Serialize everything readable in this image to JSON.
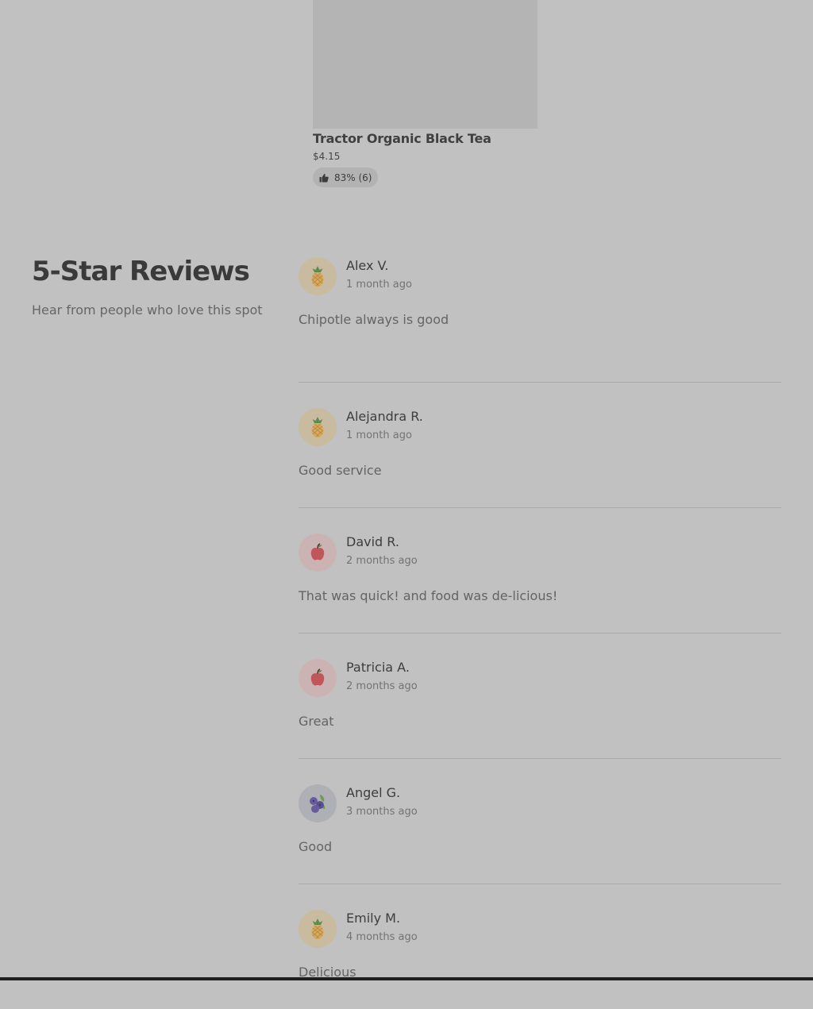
{
  "product": {
    "name": "Tractor Organic Black Tea",
    "price": "$4.15",
    "rating": "83% (6)",
    "rating_icon": "thumbs-up-icon"
  },
  "reviews_section": {
    "title": "5-Star Reviews",
    "subtitle": "Hear from people who love this spot"
  },
  "reviews": [
    {
      "name": "Alex V.",
      "date": "1 month ago",
      "text": "Chipotle always is good",
      "avatar": "pineapple-icon"
    },
    {
      "name": "Alejandra R.",
      "date": "1 month ago",
      "text": "Good service",
      "avatar": "pineapple-icon"
    },
    {
      "name": "David R.",
      "date": "2 months ago",
      "text": "That was quick! and food was de-licious!",
      "avatar": "apple-icon"
    },
    {
      "name": "Patricia A.",
      "date": "2 months ago",
      "text": "Great",
      "avatar": "apple-icon"
    },
    {
      "name": "Angel G.",
      "date": "3 months ago",
      "text": "Good",
      "avatar": "blueberry-icon"
    },
    {
      "name": "Emily M.",
      "date": "4 months ago",
      "text": "Delicious",
      "avatar": "pineapple-icon"
    }
  ]
}
